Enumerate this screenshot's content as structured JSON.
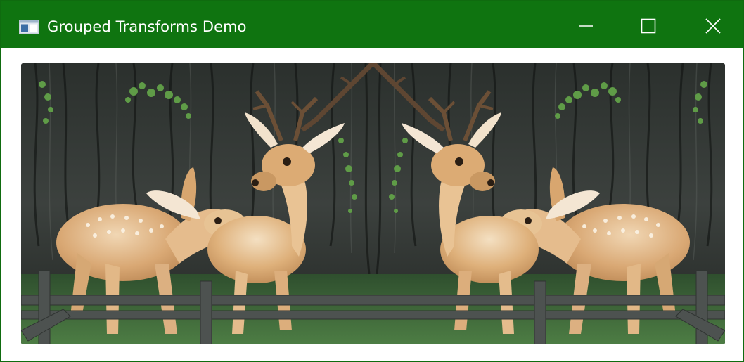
{
  "window": {
    "title": "Grouped Transforms Demo",
    "titlebar_color": "#0f7410",
    "icons": {
      "app": "app-window-icon",
      "minimize": "minimize-icon",
      "maximize": "maximize-icon",
      "close": "close-icon"
    }
  },
  "content": {
    "image": {
      "subject": "mirrored-deer-image",
      "mirrored": true
    }
  },
  "colors": {
    "bark_dark": "#1c201d",
    "bark_mid": "#3d423f",
    "deer_fawn": "#d7a66e",
    "deer_light": "#f3e3cc",
    "fence": "#4e5250",
    "grass": "#3f6e3a",
    "foliage": "#5c9a45"
  }
}
